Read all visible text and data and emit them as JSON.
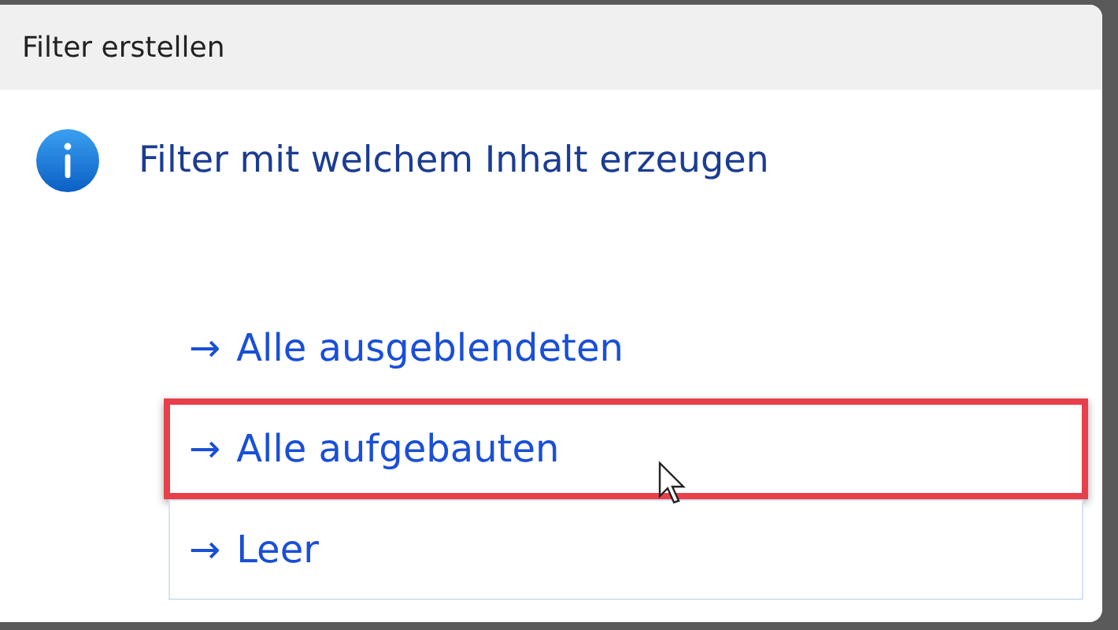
{
  "window": {
    "title": "Filter erstellen"
  },
  "heading": "Filter mit welchem Inhalt erzeugen",
  "options": [
    {
      "arrow": "→",
      "label": "Alle ausgeblendeten",
      "hovered": false,
      "marked": false
    },
    {
      "arrow": "→",
      "label": "Alle aufgebauten",
      "hovered": true,
      "marked": true
    },
    {
      "arrow": "→",
      "label": "Leer",
      "hovered": true,
      "marked": false
    }
  ]
}
